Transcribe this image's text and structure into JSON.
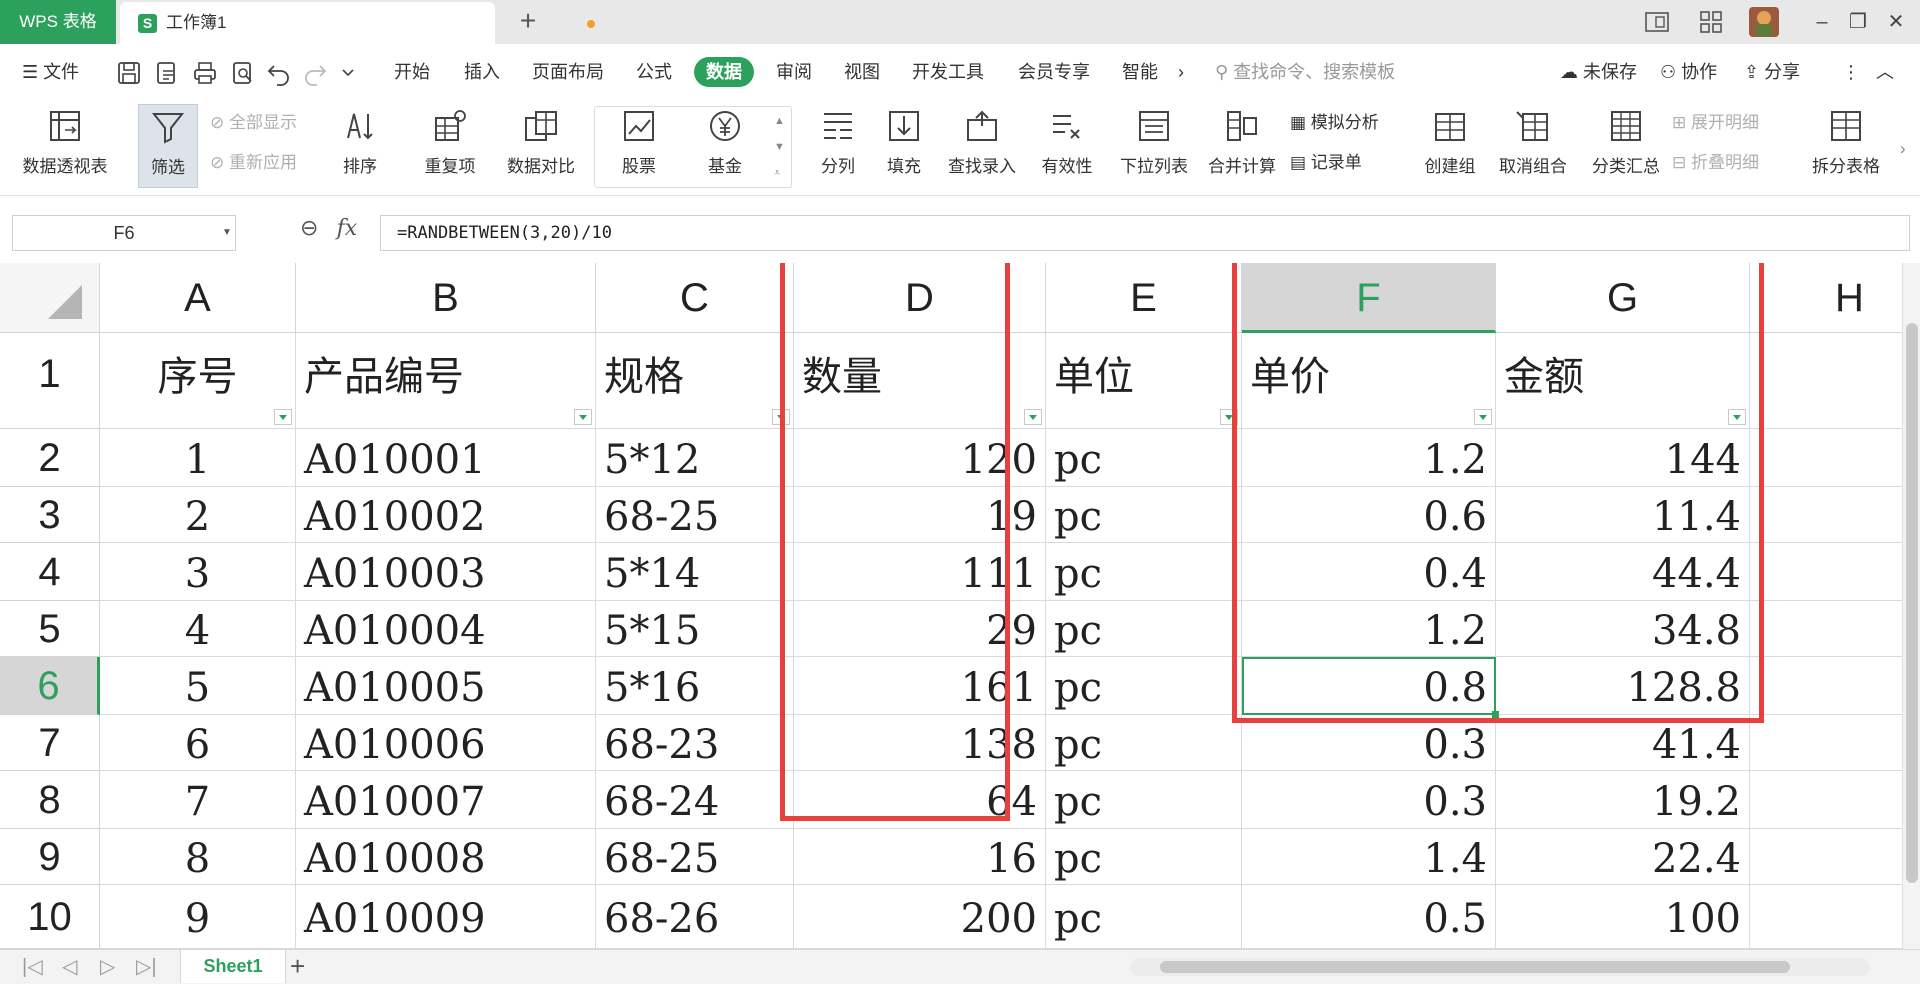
{
  "titlebar": {
    "app_tab": "WPS 表格",
    "doc_tab": "工作簿1",
    "new_tab": "+"
  },
  "menubar": {
    "file_label": "文件",
    "tabs": [
      "开始",
      "插入",
      "页面布局",
      "公式",
      "数据",
      "审阅",
      "视图",
      "开发工具",
      "会员专享",
      "智能"
    ],
    "active_tab": "数据",
    "more": "›",
    "search_placeholder": "查找命令、搜索模板",
    "unsaved": "未保存",
    "collab": "协作",
    "share": "分享"
  },
  "ribbon": {
    "pivot": "数据透视表",
    "filter": "筛选",
    "show_all": "全部显示",
    "reapply": "重新应用",
    "sort": "排序",
    "duplicates": "重复项",
    "compare": "数据对比",
    "stocks": "股票",
    "funds": "基金",
    "split_col": "分列",
    "fill": "填充",
    "find_entry": "查找录入",
    "validity": "有效性",
    "dropdown_list": "下拉列表",
    "merge_calc": "合并计算",
    "simulate": "模拟分析",
    "record_sheet": "记录单",
    "group": "创建组",
    "ungroup": "取消组合",
    "subtotal": "分类汇总",
    "expand": "展开明细",
    "collapse": "折叠明细",
    "split_table": "拆分表格"
  },
  "formula_bar": {
    "name_box": "F6",
    "fx": "fx",
    "formula": "=RANDBETWEEN(3,20)/10"
  },
  "columns": [
    "A",
    "B",
    "C",
    "D",
    "E",
    "F",
    "G",
    "H"
  ],
  "active_column": "F",
  "active_row": "6",
  "rows": [
    {
      "num": "1",
      "cells": [
        "序号",
        "产品编号",
        "规格",
        "数量",
        "单位",
        "单价",
        "金额",
        ""
      ]
    },
    {
      "num": "2",
      "cells": [
        "1",
        "A010001",
        "5*12",
        "120",
        "pc",
        "1.2",
        "144",
        ""
      ]
    },
    {
      "num": "3",
      "cells": [
        "2",
        "A010002",
        "68-25",
        "19",
        "pc",
        "0.6",
        "11.4",
        ""
      ]
    },
    {
      "num": "4",
      "cells": [
        "3",
        "A010003",
        "5*14",
        "111",
        "pc",
        "0.4",
        "44.4",
        ""
      ]
    },
    {
      "num": "5",
      "cells": [
        "4",
        "A010004",
        "5*15",
        "29",
        "pc",
        "1.2",
        "34.8",
        ""
      ]
    },
    {
      "num": "6",
      "cells": [
        "5",
        "A010005",
        "5*16",
        "161",
        "pc",
        "0.8",
        "128.8",
        ""
      ]
    },
    {
      "num": "7",
      "cells": [
        "6",
        "A010006",
        "68-23",
        "138",
        "pc",
        "0.3",
        "41.4",
        ""
      ]
    },
    {
      "num": "8",
      "cells": [
        "7",
        "A010007",
        "68-24",
        "64",
        "pc",
        "0.3",
        "19.2",
        ""
      ]
    },
    {
      "num": "9",
      "cells": [
        "8",
        "A010008",
        "68-25",
        "16",
        "pc",
        "1.4",
        "22.4",
        ""
      ]
    },
    {
      "num": "10",
      "cells": [
        "9",
        "A010009",
        "68-26",
        "200",
        "pc",
        "0.5",
        "100",
        ""
      ]
    }
  ],
  "sheetbar": {
    "sheet_name": "Sheet1",
    "add": "+"
  },
  "colors": {
    "accent": "#2ba15d",
    "annotation": "#e8403f"
  }
}
